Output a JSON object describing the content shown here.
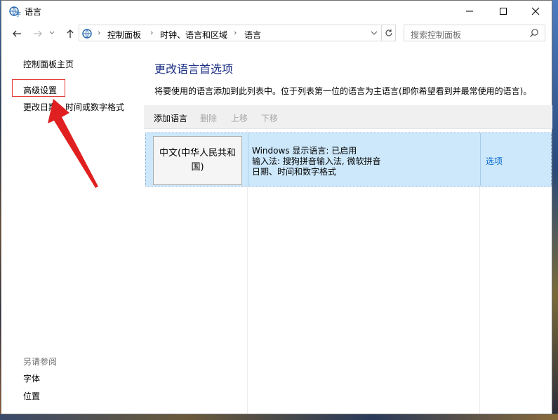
{
  "window": {
    "title": "语言"
  },
  "nav": {
    "breadcrumbs": [
      "控制面板",
      "时钟、语言和区域",
      "语言"
    ],
    "search_placeholder": "搜索控制面板"
  },
  "sidebar": {
    "home": "控制面板主页",
    "advanced": "高级设置",
    "date_format": "更改日期、时间或数字格式",
    "see_also": "另请参阅",
    "fonts": "字体",
    "location": "位置"
  },
  "main": {
    "heading": "更改语言首选项",
    "description": "将要使用的语言添加到此列表中。位于列表第一位的语言为主语言(即你希望看到并最常使用的语言)。",
    "toolbar": {
      "add": "添加语言",
      "remove": "删除",
      "up": "上移",
      "down": "下移"
    },
    "languages": [
      {
        "name": "中文(中华人民共和国)",
        "display": "Windows 显示语言: 已启用",
        "input": "输入法: 搜狗拼音输入法, 微软拼音",
        "format": "日期、时间和数字格式",
        "options": "选项"
      }
    ]
  },
  "icons": [
    "language-icon",
    "minimize-icon",
    "maximize-icon",
    "close-icon",
    "back-arrow-icon",
    "forward-arrow-icon",
    "up-arrow-icon",
    "chevron-down-icon",
    "refresh-icon",
    "search-icon"
  ],
  "colors": {
    "heading": "#1e3287",
    "selection": "#cde8fb",
    "link": "#0066cc",
    "annotation": "#e03838"
  }
}
